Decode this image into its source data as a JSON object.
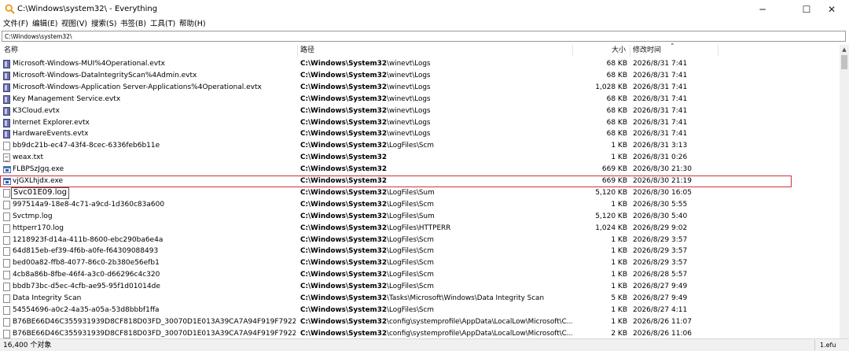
{
  "window": {
    "title": "C:\\Windows\\system32\\ - Everything",
    "minimize_glyph": "─",
    "maximize_glyph": "☐",
    "close_glyph": "✕",
    "accent_color": "#f0a020"
  },
  "menu": {
    "items": [
      {
        "label": "文件(F)"
      },
      {
        "label": "编辑(E)"
      },
      {
        "label": "视图(V)"
      },
      {
        "label": "搜索(S)"
      },
      {
        "label": "书签(B)"
      },
      {
        "label": "工具(T)"
      },
      {
        "label": "帮助(H)"
      }
    ]
  },
  "search": {
    "value": "C:\\Windows\\system32\\"
  },
  "columns": {
    "name": "名称",
    "path": "路径",
    "size": "大小",
    "date": "修改时间",
    "sort_glyph": "˄"
  },
  "rows": [
    {
      "icon": "event-log-file-icon",
      "name": "Microsoft-Windows-MUI%4Operational.evtx",
      "path_bold": "C:\\Windows\\System32",
      "path_rest": "\\winevt\\Logs",
      "size": "68 KB",
      "date": "2026/8/31 7:41"
    },
    {
      "icon": "event-log-file-icon",
      "name": "Microsoft-Windows-DataIntegrityScan%4Admin.evtx",
      "path_bold": "C:\\Windows\\System32",
      "path_rest": "\\winevt\\Logs",
      "size": "68 KB",
      "date": "2026/8/31 7:41"
    },
    {
      "icon": "event-log-file-icon",
      "name": "Microsoft-Windows-Application Server-Applications%4Operational.evtx",
      "path_bold": "C:\\Windows\\System32",
      "path_rest": "\\winevt\\Logs",
      "size": "1,028 KB",
      "date": "2026/8/31 7:41"
    },
    {
      "icon": "event-log-file-icon",
      "name": "Key Management Service.evtx",
      "path_bold": "C:\\Windows\\System32",
      "path_rest": "\\winevt\\Logs",
      "size": "68 KB",
      "date": "2026/8/31 7:41"
    },
    {
      "icon": "event-log-file-icon",
      "name": "K3Cloud.evtx",
      "path_bold": "C:\\Windows\\System32",
      "path_rest": "\\winevt\\Logs",
      "size": "68 KB",
      "date": "2026/8/31 7:41"
    },
    {
      "icon": "event-log-file-icon",
      "name": "Internet Explorer.evtx",
      "path_bold": "C:\\Windows\\System32",
      "path_rest": "\\winevt\\Logs",
      "size": "68 KB",
      "date": "2026/8/31 7:41"
    },
    {
      "icon": "event-log-file-icon",
      "name": "HardwareEvents.evtx",
      "path_bold": "C:\\Windows\\System32",
      "path_rest": "\\winevt\\Logs",
      "size": "68 KB",
      "date": "2026/8/31 7:41"
    },
    {
      "icon": "generic-file-icon",
      "name": "bb9dc21b-ec47-43f4-8cec-6336feb6b11e",
      "path_bold": "C:\\Windows\\System32",
      "path_rest": "\\LogFiles\\Scm",
      "size": "1 KB",
      "date": "2026/8/31 3:13"
    },
    {
      "icon": "text-file-icon",
      "name": "weax.txt",
      "path_bold": "C:\\Windows\\System32",
      "path_rest": "",
      "size": "1 KB",
      "date": "2026/8/31 0:26"
    },
    {
      "icon": "executable-file-icon",
      "name": "FLBPSzJgq.exe",
      "path_bold": "C:\\Windows\\System32",
      "path_rest": "",
      "size": "669 KB",
      "date": "2026/8/30 21:30"
    },
    {
      "icon": "executable-file-icon",
      "name": "vjGXLhjdx.exe",
      "path_bold": "C:\\Windows\\System32",
      "path_rest": "",
      "size": "669 KB",
      "date": "2026/8/30 21:19",
      "highlighted": true
    },
    {
      "icon": "generic-file-icon",
      "name": "Svc01E09.log",
      "path_bold": "C:\\Windows\\System32",
      "path_rest": "\\LogFiles\\Sum",
      "size": "5,120 KB",
      "date": "2026/8/30 16:05",
      "focused": true
    },
    {
      "icon": "generic-file-icon",
      "name": "997514a9-18e8-4c71-a9cd-1d360c83a600",
      "path_bold": "C:\\Windows\\System32",
      "path_rest": "\\LogFiles\\Scm",
      "size": "1 KB",
      "date": "2026/8/30 5:55"
    },
    {
      "icon": "generic-file-icon",
      "name": "Svctmp.log",
      "path_bold": "C:\\Windows\\System32",
      "path_rest": "\\LogFiles\\Sum",
      "size": "5,120 KB",
      "date": "2026/8/30 5:40"
    },
    {
      "icon": "generic-file-icon",
      "name": "httperr170.log",
      "path_bold": "C:\\Windows\\System32",
      "path_rest": "\\LogFiles\\HTTPERR",
      "size": "1,024 KB",
      "date": "2026/8/29 9:02"
    },
    {
      "icon": "generic-file-icon",
      "name": "1218923f-d14a-411b-8600-ebc290ba6e4a",
      "path_bold": "C:\\Windows\\System32",
      "path_rest": "\\LogFiles\\Scm",
      "size": "1 KB",
      "date": "2026/8/29 3:57"
    },
    {
      "icon": "generic-file-icon",
      "name": "64d815eb-ef39-4f6b-a0fe-f64309088493",
      "path_bold": "C:\\Windows\\System32",
      "path_rest": "\\LogFiles\\Scm",
      "size": "1 KB",
      "date": "2026/8/29 3:57"
    },
    {
      "icon": "generic-file-icon",
      "name": "bed00a82-ffb8-4077-86c0-2b380e56efb1",
      "path_bold": "C:\\Windows\\System32",
      "path_rest": "\\LogFiles\\Scm",
      "size": "1 KB",
      "date": "2026/8/29 3:57"
    },
    {
      "icon": "generic-file-icon",
      "name": "4cb8a86b-8fbe-46f4-a3c0-d66296c4c320",
      "path_bold": "C:\\Windows\\System32",
      "path_rest": "\\LogFiles\\Scm",
      "size": "1 KB",
      "date": "2026/8/28 5:57"
    },
    {
      "icon": "generic-file-icon",
      "name": "bbdb73bc-d5ec-4cfb-ae95-95f1d01014de",
      "path_bold": "C:\\Windows\\System32",
      "path_rest": "\\LogFiles\\Scm",
      "size": "1 KB",
      "date": "2026/8/27 9:49"
    },
    {
      "icon": "generic-file-icon",
      "name": "Data Integrity Scan",
      "path_bold": "C:\\Windows\\System32",
      "path_rest": "\\Tasks\\Microsoft\\Windows\\Data Integrity Scan",
      "size": "5 KB",
      "date": "2026/8/27 9:49"
    },
    {
      "icon": "generic-file-icon",
      "name": "54554696-a0c2-4a35-a05a-53d8bbbf1ffa",
      "path_bold": "C:\\Windows\\System32",
      "path_rest": "\\LogFiles\\Scm",
      "size": "1 KB",
      "date": "2026/8/27 4:11"
    },
    {
      "icon": "generic-file-icon",
      "name": "B76BE66D46C355931939D8CF818D03FD_30070D1E013A39CA7A94F919F7922FDF",
      "path_bold": "C:\\Windows\\System32",
      "path_rest": "\\config\\systemprofile\\AppData\\LocalLow\\Microsoft\\C...",
      "size": "1 KB",
      "date": "2026/8/26 11:07"
    },
    {
      "icon": "generic-file-icon",
      "name": "B76BE66D46C355931939D8CF818D03FD_30070D1E013A39CA7A94F919F7922FDF",
      "path_bold": "C:\\Windows\\System32",
      "path_rest": "\\config\\systemprofile\\AppData\\LocalLow\\Microsoft\\C...",
      "size": "2 KB",
      "date": "2026/8/26 11:06"
    }
  ],
  "status": {
    "count": "16,400 个对象",
    "database": "1.efu"
  }
}
